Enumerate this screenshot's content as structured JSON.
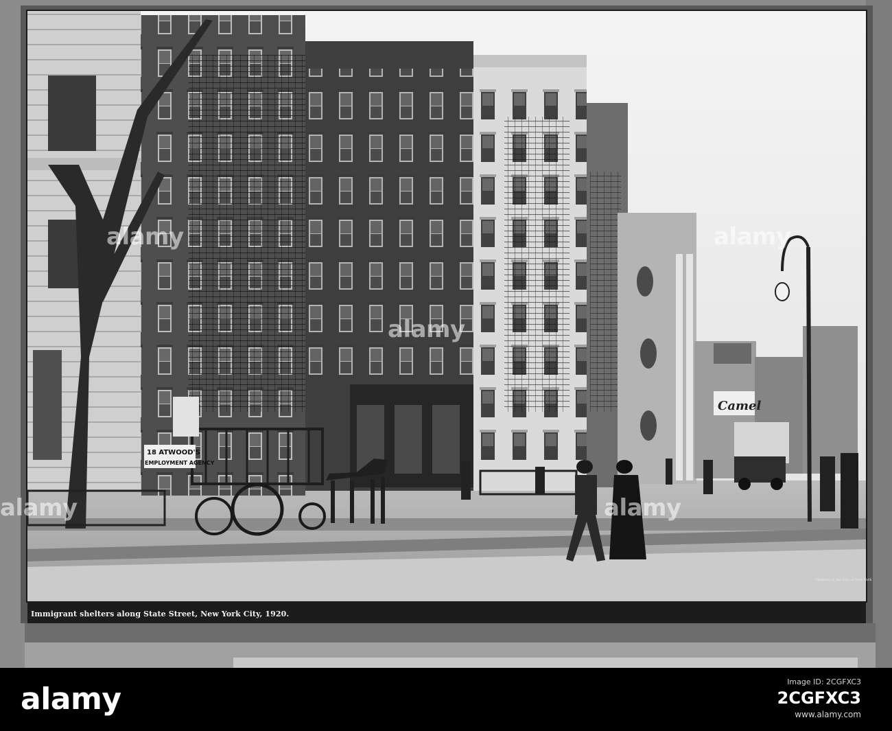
{
  "photo": {
    "caption": "Immigrant shelters along State Street, New York City, 1920.",
    "credit": "Museum of the City of New York",
    "signs": {
      "agency_line1": "18 ATWOOD'S",
      "agency_line2": "EMPLOYMENT AGENCY",
      "billboard": "Camel"
    }
  },
  "watermark": {
    "text": "alamy",
    "brand_color": "#ffffff"
  },
  "banner": {
    "logo": "alamy",
    "image_id_label": "Image ID: 2CGFXC3",
    "image_id": "2CGFXC3",
    "site": "www.alamy.com"
  }
}
